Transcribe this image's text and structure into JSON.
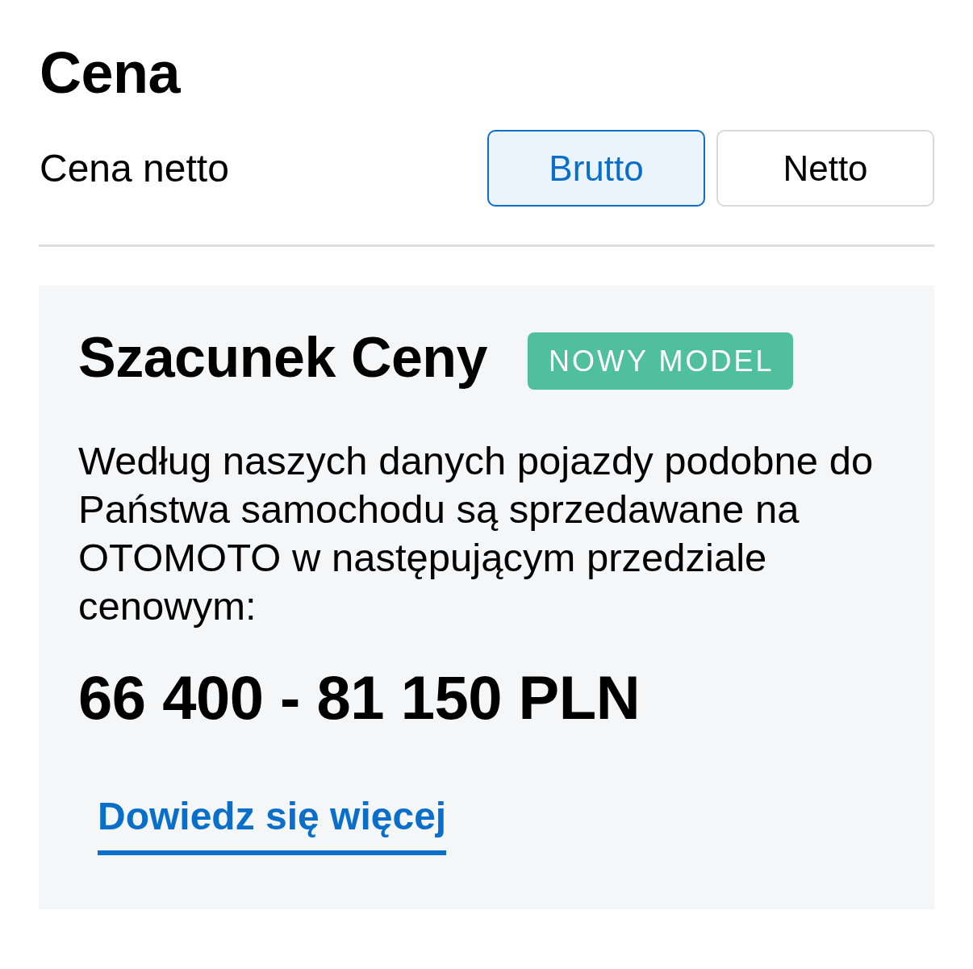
{
  "title": "Cena",
  "price_type": {
    "label": "Cena netto",
    "options": [
      {
        "label": "Brutto",
        "selected": true
      },
      {
        "label": "Netto",
        "selected": false
      }
    ]
  },
  "estimate": {
    "title": "Szacunek Ceny",
    "badge": "NOWY MODEL",
    "description": "Według naszych danych pojazdy podobne do Państwa samochodu są sprzedawane na OTOMOTO w następującym przedziale cenowym:",
    "price_range": "66 400 - 81 150 PLN",
    "link": "Dowiedz się więcej"
  }
}
